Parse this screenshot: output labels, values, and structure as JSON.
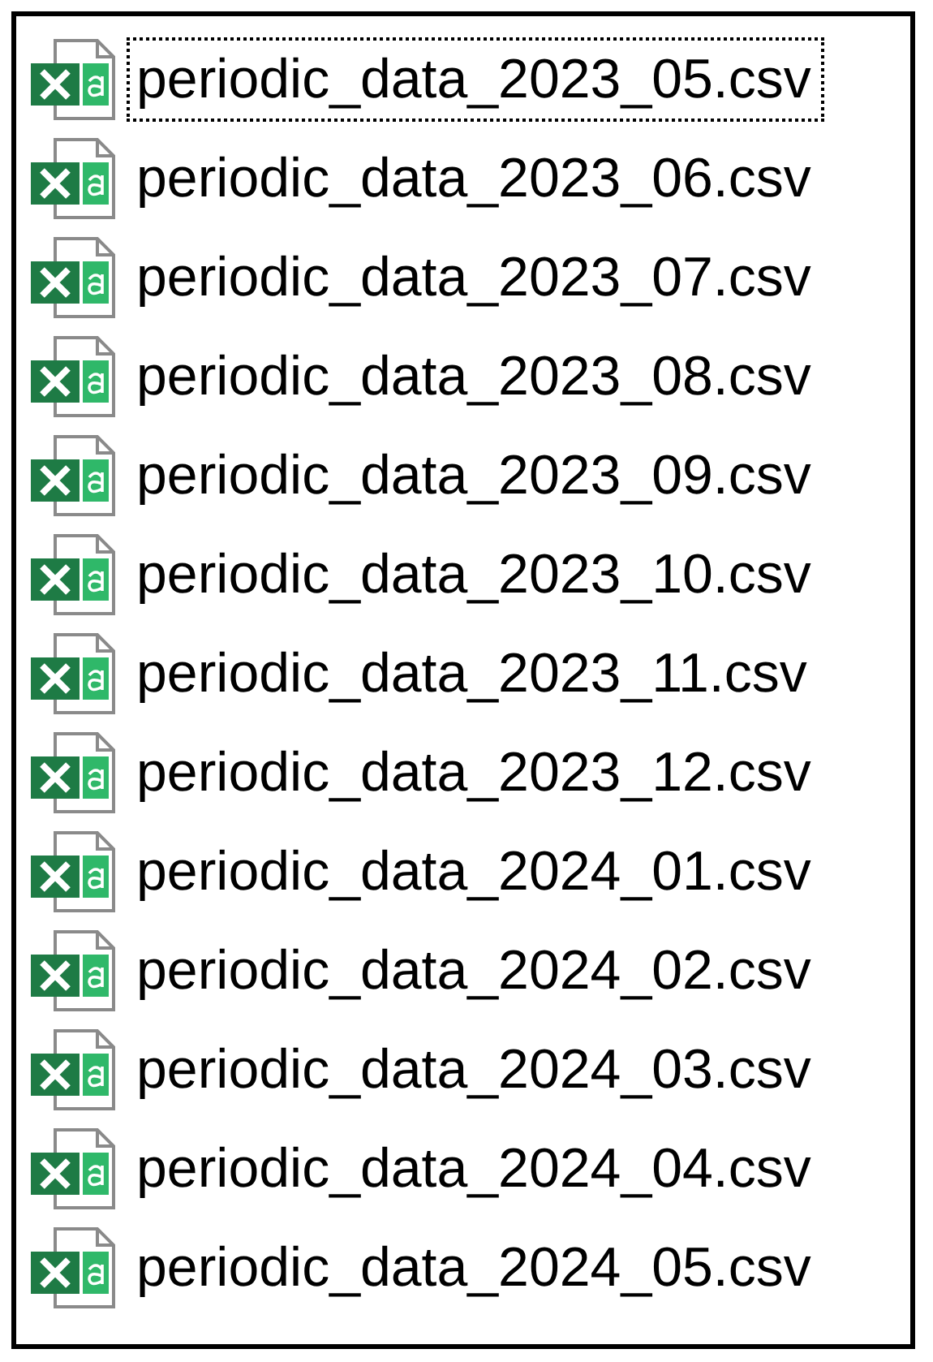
{
  "files": [
    {
      "name": "periodic_data_2023_05.csv",
      "focused": true
    },
    {
      "name": "periodic_data_2023_06.csv",
      "focused": false
    },
    {
      "name": "periodic_data_2023_07.csv",
      "focused": false
    },
    {
      "name": "periodic_data_2023_08.csv",
      "focused": false
    },
    {
      "name": "periodic_data_2023_09.csv",
      "focused": false
    },
    {
      "name": "periodic_data_2023_10.csv",
      "focused": false
    },
    {
      "name": "periodic_data_2023_11.csv",
      "focused": false
    },
    {
      "name": "periodic_data_2023_12.csv",
      "focused": false
    },
    {
      "name": "periodic_data_2024_01.csv",
      "focused": false
    },
    {
      "name": "periodic_data_2024_02.csv",
      "focused": false
    },
    {
      "name": "periodic_data_2024_03.csv",
      "focused": false
    },
    {
      "name": "periodic_data_2024_04.csv",
      "focused": false
    },
    {
      "name": "periodic_data_2024_05.csv",
      "focused": false
    }
  ]
}
